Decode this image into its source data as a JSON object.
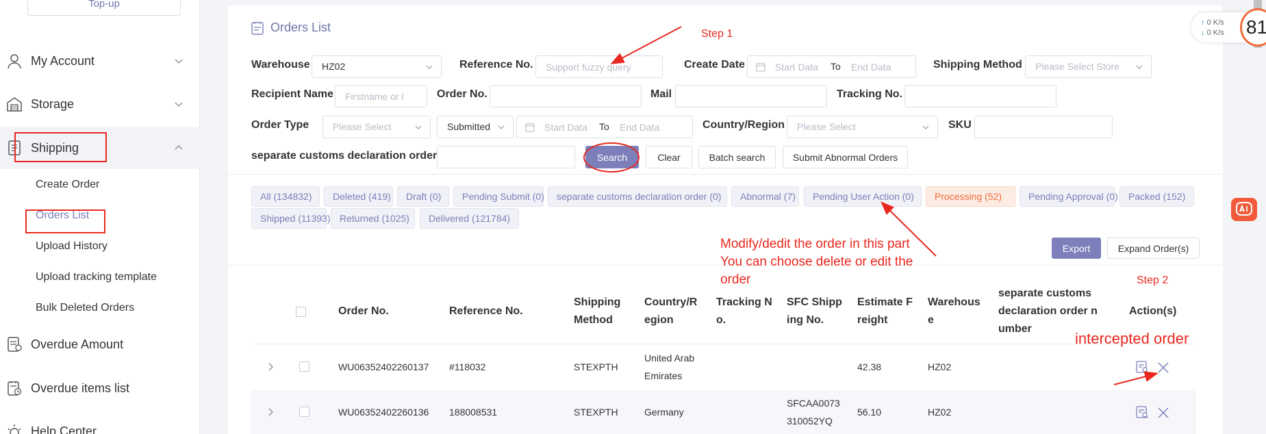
{
  "sidebar": {
    "topup_label": "Top-up",
    "items": [
      {
        "label": "My Account",
        "icon": "user-icon"
      },
      {
        "label": "Storage",
        "icon": "storage-icon"
      },
      {
        "label": "Shipping",
        "icon": "shipping-icon"
      },
      {
        "label": "Overdue Amount",
        "icon": "overdue-amount-icon"
      },
      {
        "label": "Overdue items list",
        "icon": "overdue-list-icon"
      },
      {
        "label": "Help Center",
        "icon": "help-center-icon"
      }
    ],
    "shipping_sub": [
      "Create Order",
      "Orders List",
      "Upload History",
      "Upload tracking template",
      "Bulk Deleted Orders"
    ]
  },
  "page": {
    "title": "Orders List"
  },
  "filters": {
    "warehouse_label": "Warehouse",
    "warehouse_value": "HZ02",
    "reference_label": "Reference No.",
    "reference_placeholder": "Support fuzzy query",
    "create_date_label": "Create Date",
    "shipping_method_label": "Shipping Method",
    "shipping_method_placeholder": "Please Select Store",
    "recipient_label": "Recipient Name",
    "recipient_placeholder": "Firstname or l",
    "order_no_label": "Order No.",
    "mail_label": "Mail",
    "tracking_label": "Tracking No.",
    "order_type_label": "Order Type",
    "order_type_placeholder": "Please Select",
    "status_value": "Submitted",
    "country_label": "Country/Region",
    "country_placeholder": "Please Select",
    "sku_label": "SKU",
    "separate_label": "separate customs declaration order",
    "date_start": "Start Data",
    "date_to": "To",
    "date_end": "End Data"
  },
  "buttons": {
    "search": "Search",
    "clear": "Clear",
    "batch_search": "Batch search",
    "submit_abnormal": "Submit Abnormal Orders",
    "export": "Export",
    "expand_orders": "Expand Order(s)"
  },
  "tabs": [
    "All (134832)",
    "Deleted (419)",
    "Draft (0)",
    "Pending Submit (0)",
    "separate customs declaration order (0)",
    "Abnormal (7)",
    "Pending User Action (0)",
    "Processing (52)",
    "Pending Approval (0)",
    "Packed (152)",
    "Shipped (11393)",
    "Returned (1025)",
    "Delivered (121784)"
  ],
  "active_tab": "Processing (52)",
  "table": {
    "headers": {
      "order_no": "Order No.",
      "reference_no": "Reference No.",
      "shipping_method": [
        "Shipping",
        "Method"
      ],
      "country": [
        "Country/R",
        "egion"
      ],
      "tracking": [
        "Tracking N",
        "o."
      ],
      "sfc": [
        "SFC Shipp",
        "ing No."
      ],
      "freight": [
        "Estimate F",
        "reight"
      ],
      "warehouse": [
        "Warehous",
        "e"
      ],
      "separate": [
        "separate customs",
        "declaration order n",
        "umber"
      ],
      "actions": "Action(s)"
    },
    "rows": [
      {
        "order_no": "WU06352402260137",
        "reference_no": "#118032",
        "shipping_method": "STEXPTH",
        "country": [
          "United Arab",
          "Emirates"
        ],
        "tracking": "",
        "sfc": [
          "",
          ""
        ],
        "freight": "42.38",
        "warehouse": "HZ02"
      },
      {
        "order_no": "WU06352402260136",
        "reference_no": "188008531",
        "shipping_method": "STEXPTH",
        "country": [
          "Germany",
          ""
        ],
        "tracking": "",
        "sfc": [
          "SFCAA0073",
          "310052YQ"
        ],
        "freight": "56.10",
        "warehouse": "HZ02"
      }
    ]
  },
  "annotations": {
    "step1": "Step 1",
    "step2": "Step 2",
    "modify": [
      "Modify/dedit  the order in this part",
      "You can choose delete or edit the",
      "order"
    ],
    "intercepted": "intercepted order"
  },
  "widgets": {
    "speed_up": "0",
    "speed_down": "0",
    "speed_unit": "K/s",
    "gauge": "81"
  },
  "colors": {
    "accent": "#7c7fba",
    "annotation": "#e8281f",
    "processing": "#f06b3a"
  }
}
